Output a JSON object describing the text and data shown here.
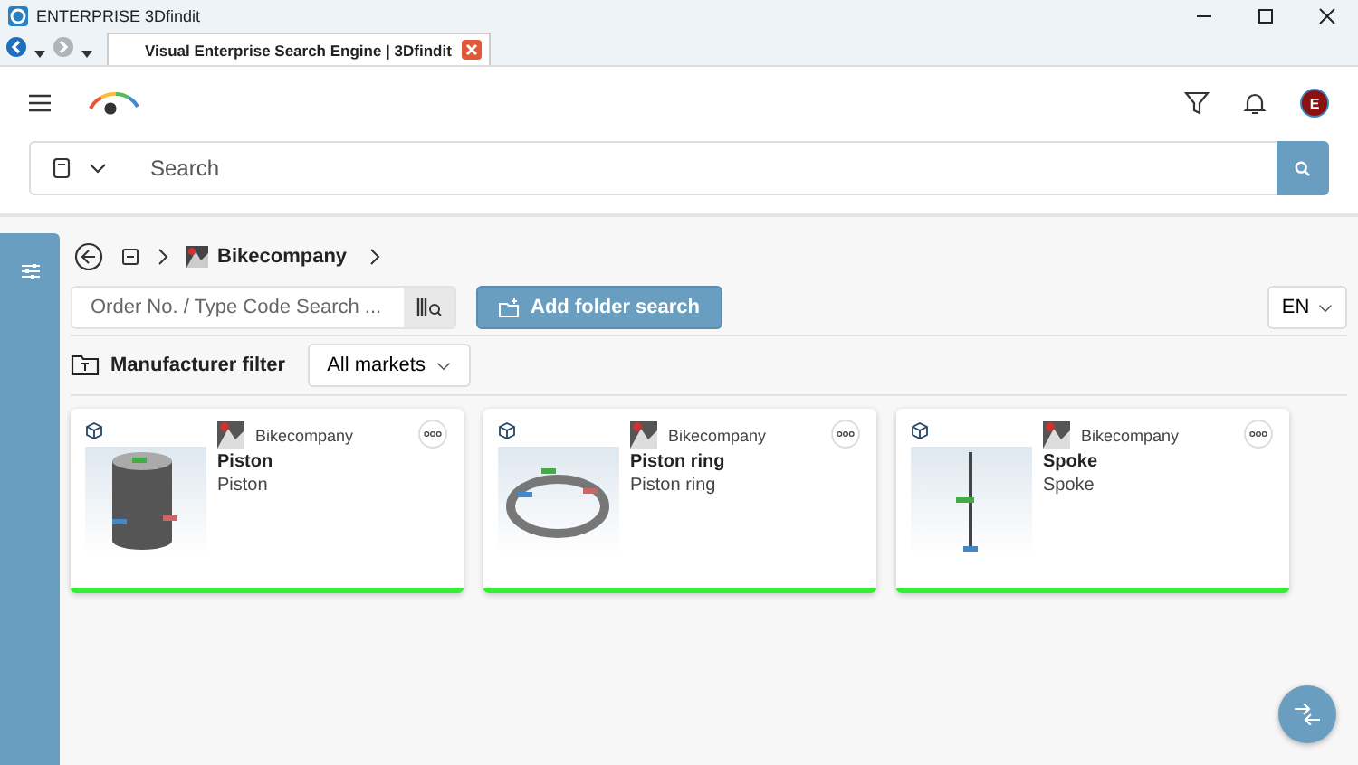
{
  "window": {
    "title": "ENTERPRISE 3Dfindit"
  },
  "browser_tab": {
    "title": "Visual Enterprise Search Engine | 3Dfindit"
  },
  "header": {
    "avatar_letter": "E"
  },
  "search": {
    "placeholder": "Search"
  },
  "breadcrumb": {
    "label": "Bikecompany"
  },
  "order_search": {
    "placeholder": "Order No. / Type Code Search ..."
  },
  "add_folder_button": "Add folder search",
  "language": "EN",
  "manufacturer_filter": {
    "label": "Manufacturer filter",
    "market": "All markets"
  },
  "cards": [
    {
      "kind": "cylinder",
      "manufacturer": "Bikecompany",
      "title": "Piston",
      "subtitle": "Piston"
    },
    {
      "kind": "ring",
      "manufacturer": "Bikecompany",
      "title": "Piston ring",
      "subtitle": "Piston ring"
    },
    {
      "kind": "rod",
      "manufacturer": "Bikecompany",
      "title": "Spoke",
      "subtitle": "Spoke"
    }
  ]
}
